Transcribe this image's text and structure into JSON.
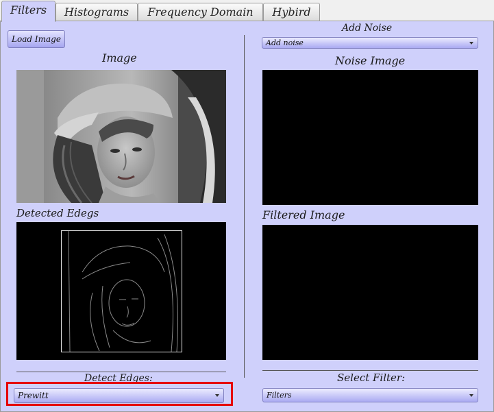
{
  "tabs": [
    {
      "label": "Filters",
      "active": true
    },
    {
      "label": "Histograms",
      "active": false
    },
    {
      "label": "Frequency Domain",
      "active": false
    },
    {
      "label": "Hybird",
      "active": false
    }
  ],
  "left": {
    "load_button": "Load Image",
    "image_label": "Image",
    "edges_label": "Detected Edegs",
    "detect_label": "Detect Edges:",
    "detect_combo_value": "Prewitt"
  },
  "right": {
    "noise_label": "Add Noise",
    "noise_combo_value": "Add noise",
    "noise_image_label": "Noise Image",
    "filtered_label": "Filtered Image",
    "filter_label": "Select Filter:",
    "filter_combo_value": "Filters"
  },
  "colors": {
    "panel": "#cfd0fb",
    "highlight": "#e60000"
  }
}
